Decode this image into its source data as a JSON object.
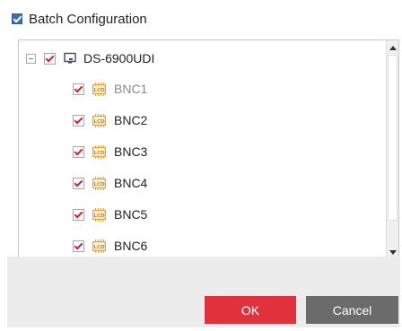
{
  "header": {
    "label": "Batch Configuration",
    "checked": true
  },
  "tree": {
    "root": {
      "label": "DS-6900UDI",
      "checked": true,
      "icon": "monitor-device-icon"
    },
    "items": [
      {
        "label": "BNC1",
        "checked": true,
        "icon": "lcd-chip-icon",
        "dimmed": true
      },
      {
        "label": "BNC2",
        "checked": true,
        "icon": "lcd-chip-icon"
      },
      {
        "label": "BNC3",
        "checked": true,
        "icon": "lcd-chip-icon"
      },
      {
        "label": "BNC4",
        "checked": true,
        "icon": "lcd-chip-icon"
      },
      {
        "label": "BNC5",
        "checked": true,
        "icon": "lcd-chip-icon"
      },
      {
        "label": "BNC6",
        "checked": true,
        "icon": "lcd-chip-icon"
      }
    ]
  },
  "buttons": {
    "ok": "OK",
    "cancel": "Cancel"
  },
  "colors": {
    "ok_bg": "#e0313d",
    "cancel_bg": "#6b6b6b",
    "check_red": "#d2202f",
    "icon_orange": "#e8a33b"
  }
}
